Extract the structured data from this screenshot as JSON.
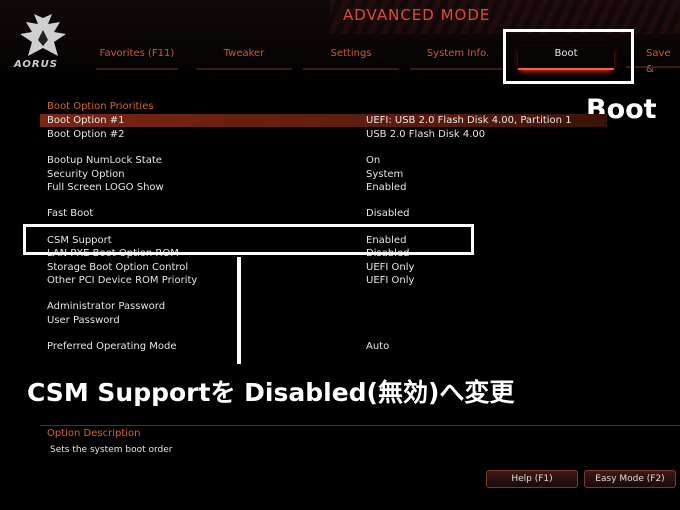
{
  "header": {
    "mode_title": "ADVANCED MODE",
    "logo_text": "AORUS"
  },
  "tabs": [
    {
      "label": "Favorites (F11)"
    },
    {
      "label": "Tweaker"
    },
    {
      "label": "Settings"
    },
    {
      "label": "System Info."
    },
    {
      "label": "Boot"
    },
    {
      "label": "Save &"
    }
  ],
  "annotations": {
    "boot_label": "Boot",
    "instruction": "CSM Supportを Disabled(無効)へ変更"
  },
  "boot": {
    "section_title": "Boot Option Priorities",
    "rows": [
      {
        "label": "Boot Option #1",
        "value": "UEFI: USB 2.0 Flash Disk 4.00, Partition 1"
      },
      {
        "label": "Boot Option #2",
        "value": "USB 2.0 Flash Disk 4.00"
      },
      {
        "label": "Bootup NumLock State",
        "value": "On"
      },
      {
        "label": "Security Option",
        "value": "System"
      },
      {
        "label": "Full Screen LOGO Show",
        "value": "Enabled"
      },
      {
        "label": "Fast Boot",
        "value": "Disabled"
      },
      {
        "label": "CSM Support",
        "value": "Enabled"
      },
      {
        "label": "LAN PXE Boot Option ROM",
        "value": "Disabled"
      },
      {
        "label": "Storage Boot Option Control",
        "value": "UEFI Only"
      },
      {
        "label": "Other PCI Device ROM Priority",
        "value": "UEFI Only"
      },
      {
        "label": "Administrator Password",
        "value": ""
      },
      {
        "label": "User Password",
        "value": ""
      },
      {
        "label": "Preferred Operating Mode",
        "value": "Auto"
      }
    ]
  },
  "description": {
    "title": "Option Description",
    "text": "Sets the system boot order"
  },
  "footer": {
    "help_label": "Help (F1)",
    "easy_mode_label": "Easy Mode (F2)"
  },
  "colors": {
    "accent": "#ff5a3a",
    "section": "#d2691e",
    "background": "#000000"
  }
}
